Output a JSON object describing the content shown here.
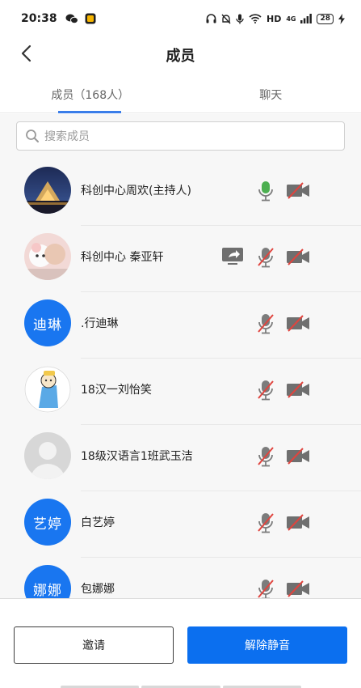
{
  "status_bar": {
    "time": "20:38",
    "network_label": "HD",
    "signal_label": "4G",
    "battery": "28"
  },
  "header": {
    "title": "成员"
  },
  "tabs": [
    {
      "label": "成员（168人）",
      "active": true
    },
    {
      "label": "聊天",
      "active": false
    }
  ],
  "search": {
    "placeholder": "搜索成员"
  },
  "members": [
    {
      "name": "科创中心周欢(主持人)",
      "avatar": "photo-night-building",
      "mic": "active",
      "camera": "off",
      "sharing": false
    },
    {
      "name": "科创中心 秦亚轩",
      "avatar": "photo-plush-toy",
      "mic": "muted",
      "camera": "off",
      "sharing": true
    },
    {
      "name": ".行迪琳",
      "avatar_text": "迪琳",
      "mic": "muted",
      "camera": "off",
      "sharing": false
    },
    {
      "name": "18汉一刘怡笑",
      "avatar": "cartoon-character",
      "mic": "muted",
      "camera": "off",
      "sharing": false
    },
    {
      "name": "18级汉语言1班武玉洁",
      "avatar": "default-person",
      "mic": "muted",
      "camera": "off",
      "sharing": false
    },
    {
      "name": "白艺婷",
      "avatar_text": "艺婷",
      "mic": "muted",
      "camera": "off",
      "sharing": false
    },
    {
      "name": "包娜娜",
      "avatar_text": "娜娜",
      "mic": "muted",
      "camera": "off",
      "sharing": false
    }
  ],
  "actions": {
    "invite_label": "邀请",
    "unmute_all_label": "解除静音"
  },
  "colors": {
    "accent": "#0b6fef",
    "avatar_blue": "#1976f0",
    "mic_active": "#4caf50",
    "muted_red": "#e0443e"
  }
}
